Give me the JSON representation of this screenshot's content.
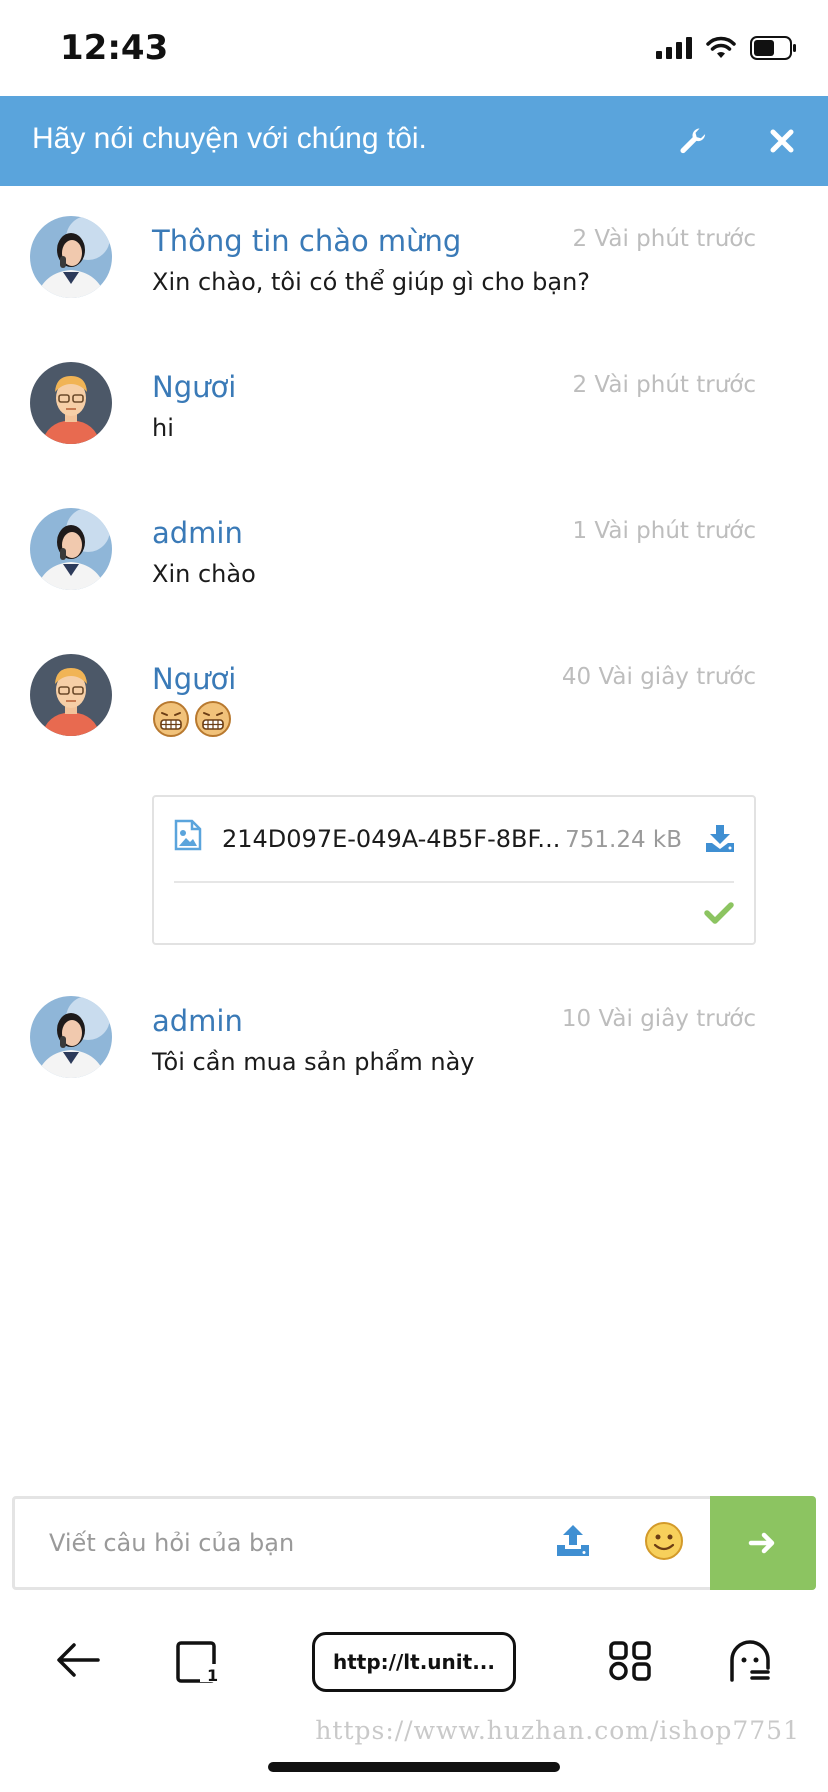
{
  "status_bar": {
    "time": "12:43"
  },
  "header": {
    "title": "Hãy nói chuyện với chúng tôi."
  },
  "messages": [
    {
      "name": "Thông tin chào mừng",
      "time": "2 Vài phút trước",
      "text": "Xin chào, tôi có thể giúp gì cho bạn?",
      "avatar": "agent"
    },
    {
      "name": "Ngươi",
      "time": "2 Vài phút trước",
      "text": "hi",
      "avatar": "user"
    },
    {
      "name": "admin",
      "time": "1 Vài phút trước",
      "text": "Xin chào",
      "avatar": "agent"
    },
    {
      "name": "Ngươi",
      "time": "40 Vài giây trước",
      "text": "",
      "avatar": "user",
      "emoji": [
        "grimacing-emoji",
        "grimacing-emoji"
      ]
    },
    {
      "name": "admin",
      "time": "10 Vài giây trước",
      "text": "Tôi cần mua sản phẩm này",
      "avatar": "agent"
    }
  ],
  "file": {
    "name": "214D097E-049A-4B5F-8BF...",
    "size": "751.24 kB"
  },
  "input": {
    "placeholder": "Viết câu hỏi của bạn",
    "value": ""
  },
  "browser": {
    "url": "http://lt.unit..."
  },
  "watermark": "https://www.huzhan.com/ishop7751",
  "colors": {
    "header": "#5aa4dc",
    "name": "#3a7ab7",
    "send": "#8cc461",
    "check": "#8cc461",
    "time": "#bdbdbd"
  }
}
